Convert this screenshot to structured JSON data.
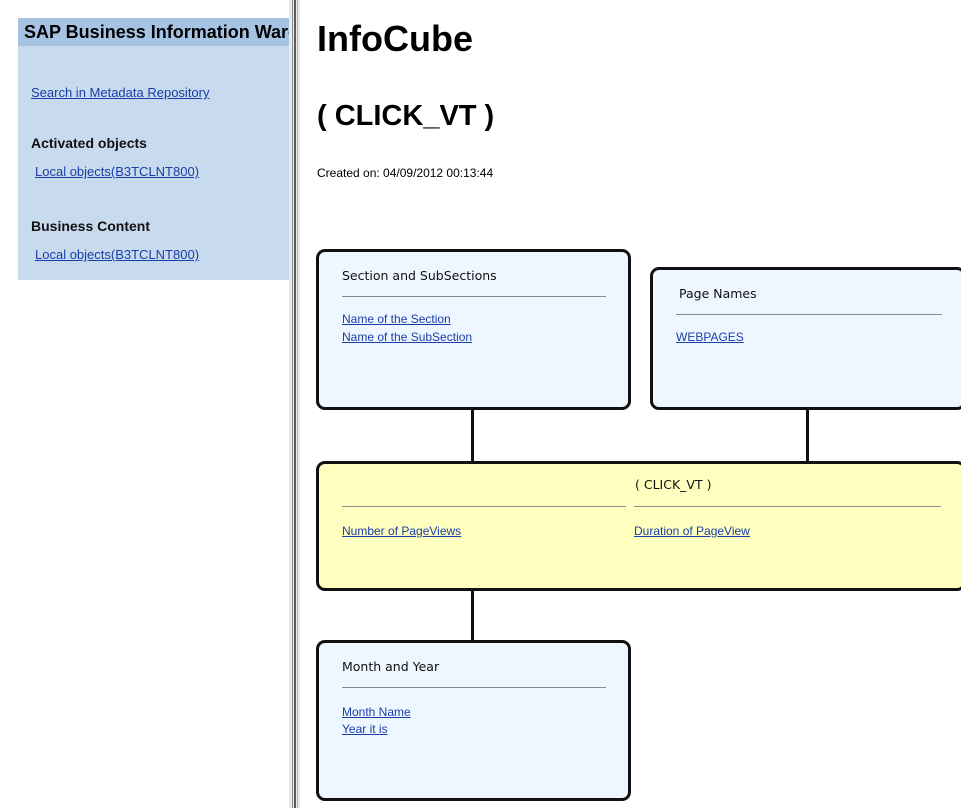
{
  "nav": {
    "header": "SAP Business Information Warehouse",
    "search_link": "Search in Metadata Repository",
    "activated_heading": "Activated objects",
    "activated_link": "Local objects(B3TCLNT800)",
    "business_heading": "Business Content",
    "business_link": "Local objects(B3TCLNT800)"
  },
  "main": {
    "title": "InfoCube",
    "subtitle": "( CLICK_VT )",
    "created": "Created on: 04/09/2012 00:13:44"
  },
  "diagram": {
    "section_box": {
      "title": "Section and SubSections",
      "links": [
        "Name of the Section",
        "Name of the SubSection"
      ]
    },
    "page_names_box": {
      "title": "Page Names",
      "links": [
        "WEBPAGES"
      ]
    },
    "cube_box": {
      "title": "( CLICK_VT )",
      "key_figures": [
        "Number of PageViews",
        "Duration of PageView"
      ]
    },
    "time_box": {
      "title": "Month and Year",
      "links": [
        "Month Name",
        "Year it is"
      ]
    }
  },
  "colors": {
    "nav_panel": "#c8daed",
    "nav_header": "#a6c3e3",
    "dimension_box": "#eef6ff",
    "cube_box": "#ffffc0",
    "link": "#1a3ea8"
  }
}
